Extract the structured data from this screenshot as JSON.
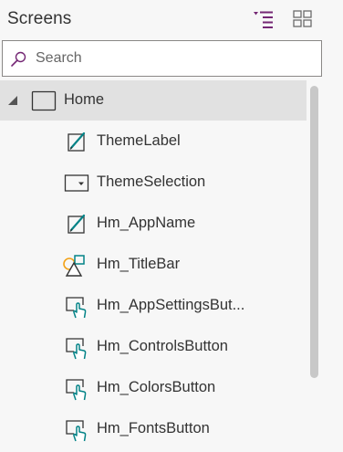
{
  "panel": {
    "title": "Screens",
    "tree_view_icon": "tree-view-icon",
    "grid_view_icon": "grid-view-icon"
  },
  "search": {
    "placeholder": "Search",
    "value": "",
    "icon": "search-icon"
  },
  "tree": {
    "screen": {
      "label": "Home",
      "icon": "screen-icon",
      "expanded": true,
      "selected": true
    },
    "children": [
      {
        "label": "ThemeLabel",
        "icon": "label-edit-icon"
      },
      {
        "label": "ThemeSelection",
        "icon": "dropdown-control-icon"
      },
      {
        "label": "Hm_AppName",
        "icon": "label-edit-icon"
      },
      {
        "label": "Hm_TitleBar",
        "icon": "shapes-icon"
      },
      {
        "label": "Hm_AppSettingsBut...",
        "icon": "button-touch-icon"
      },
      {
        "label": "Hm_ControlsButton",
        "icon": "button-touch-icon"
      },
      {
        "label": "Hm_ColorsButton",
        "icon": "button-touch-icon"
      },
      {
        "label": "Hm_FontsButton",
        "icon": "button-touch-icon"
      }
    ]
  },
  "colors": {
    "accent": "#742774",
    "touch_icon": "#038387",
    "shape_circle": "#f2a218",
    "selected_row": "#e1e1e1"
  }
}
